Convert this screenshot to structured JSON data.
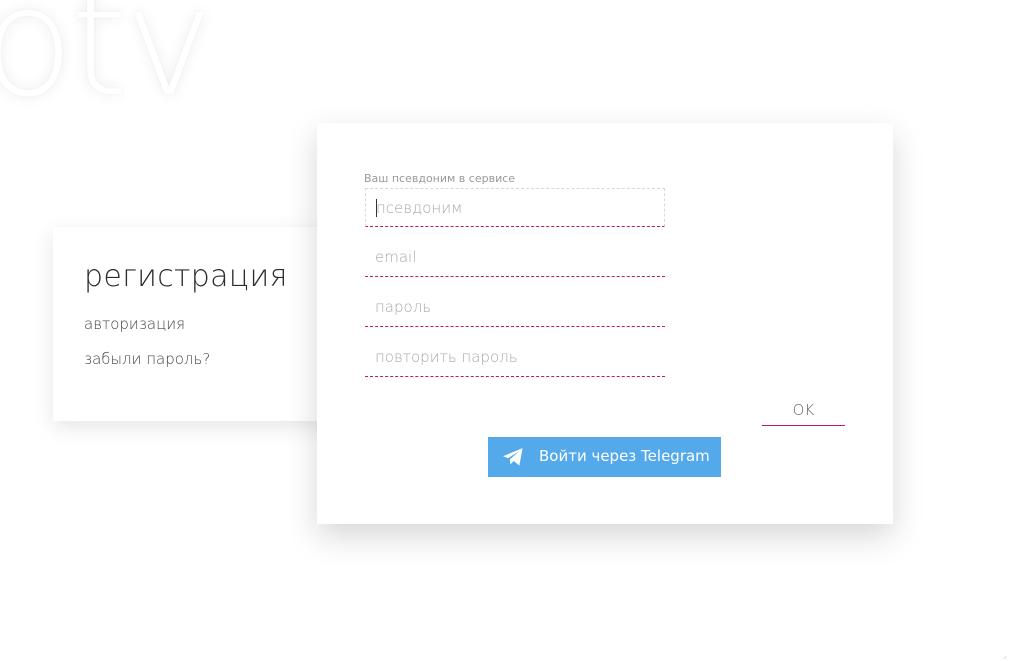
{
  "background": {
    "logo_text": "otv"
  },
  "sidebar": {
    "title": "регистрация",
    "links": [
      "авторизация",
      "забыли пароль?"
    ]
  },
  "form": {
    "nickname_caption": "Ваш псевдоним в сервисе",
    "nickname_placeholder": "псевдоним",
    "email_placeholder": "email",
    "password_placeholder": "пароль",
    "repeat_password_placeholder": "повторить пароль",
    "submit_label": "OK",
    "telegram_label": "Войти через Telegram"
  },
  "colors": {
    "accent": "#c2186b",
    "telegram": "#54a9eb"
  },
  "icons": {
    "telegram": "paper-plane-icon"
  }
}
